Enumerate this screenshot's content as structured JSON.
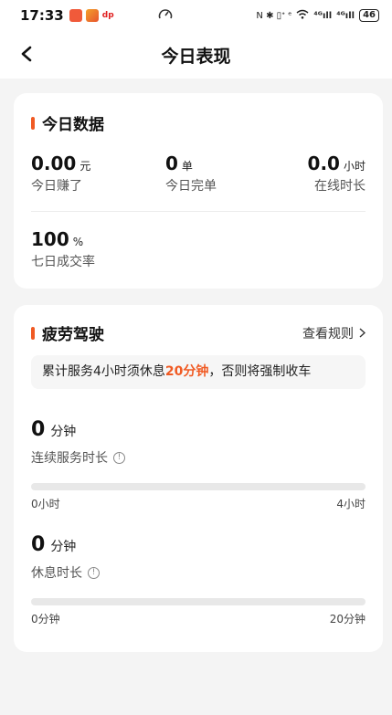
{
  "statusbar": {
    "time": "17:33",
    "app_text": "dp",
    "gauge_icon": "speedometer-icon",
    "right_icons": "N ✱ ▯ᐩ ᵉ",
    "signal1": "⁴ᴳıll",
    "signal2": "⁴ᴳıll",
    "battery": "46"
  },
  "nav": {
    "title": "今日表现"
  },
  "today_data": {
    "title": "今日数据",
    "earned": {
      "value": "0.00",
      "unit": "元",
      "label": "今日赚了"
    },
    "orders": {
      "value": "0",
      "unit": "单",
      "label": "今日完单"
    },
    "online": {
      "value": "0.0",
      "unit": "小时",
      "label": "在线时长"
    },
    "rate": {
      "value": "100",
      "unit": "%",
      "label": "七日成交率"
    }
  },
  "fatigue": {
    "title": "疲劳驾驶",
    "rules_link": "查看规则",
    "notice_pre": "累计服务4小时须休息",
    "notice_hl": "20分钟",
    "notice_post": "，否则将强制收车",
    "service": {
      "value": "0",
      "unit": "分钟",
      "label": "连续服务时长",
      "progress": 0,
      "min_label": "0小时",
      "max_label": "4小时"
    },
    "rest": {
      "value": "0",
      "unit": "分钟",
      "label": "休息时长",
      "progress": 0,
      "min_label": "0分钟",
      "max_label": "20分钟"
    }
  },
  "colors": {
    "accent": "#f05a23",
    "background": "#f4f4f4",
    "track": "#e8e8e8"
  }
}
